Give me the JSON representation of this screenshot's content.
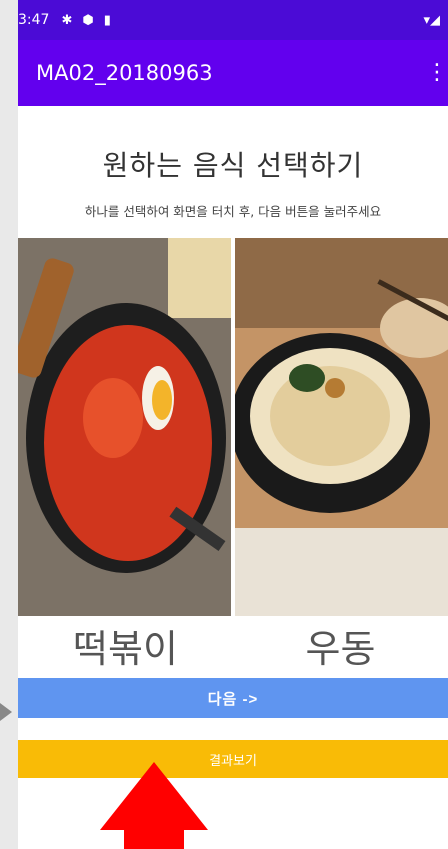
{
  "statusbar": {
    "time": "3:47"
  },
  "appbar": {
    "title": "MA02_20180963"
  },
  "main": {
    "heading": "원하는 음식 선택하기",
    "subtitle": "하나를 선택하여 화면을 터치 후, 다음 버튼을 눌러주세요",
    "options": [
      {
        "label": "떡볶이",
        "image": "tteokbokki-image"
      },
      {
        "label": "우동",
        "image": "udon-image"
      }
    ],
    "next_button": "다음 ->",
    "result_button": "결과보기"
  },
  "colors": {
    "statusbar": "#4b0bd6",
    "appbar": "#6200ee",
    "next_button": "#5f95f0",
    "result_button": "#f9bb06",
    "annotation_arrow": "#ff0000"
  }
}
